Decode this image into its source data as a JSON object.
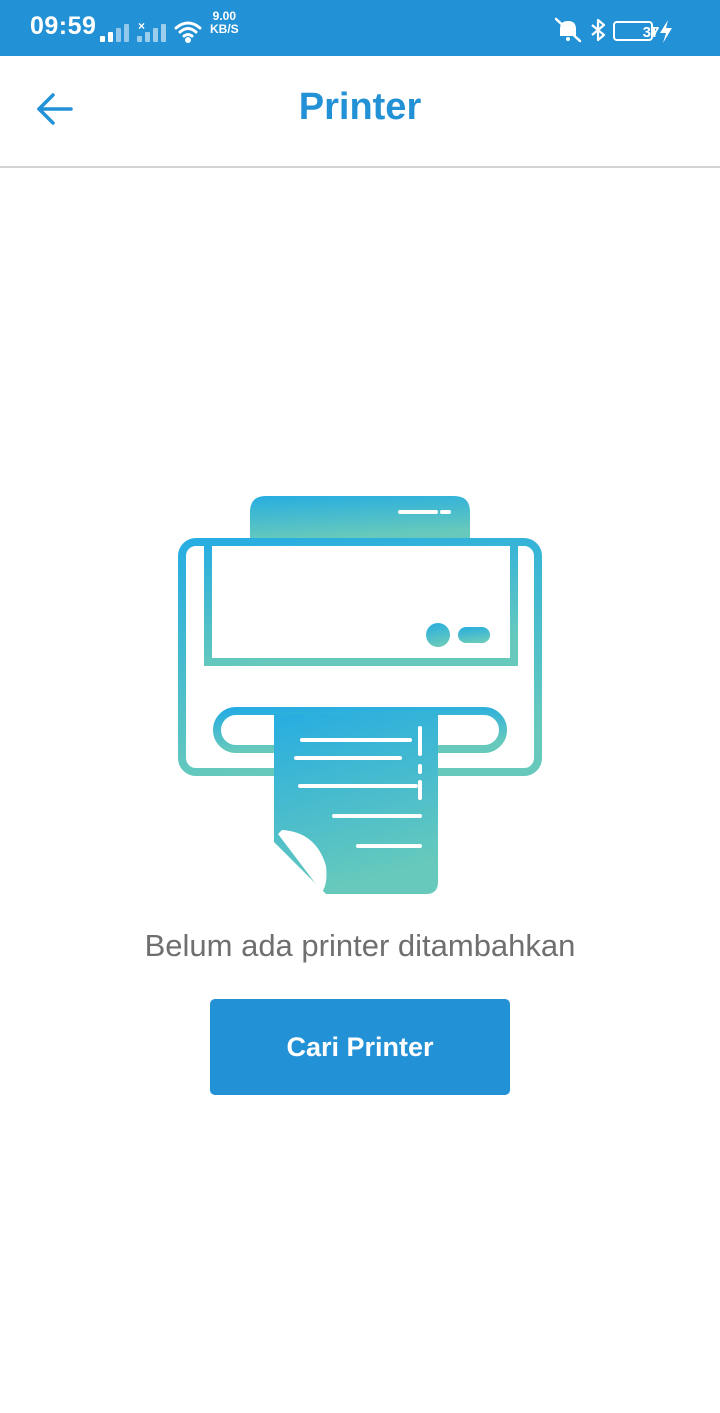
{
  "status_bar": {
    "time": "09:59",
    "net_speed_value": "9.00",
    "net_speed_unit": "KB/S",
    "battery_level": "37",
    "icons": [
      "signal-icon",
      "signal-no-service-icon",
      "wifi-icon",
      "mute-icon",
      "bluetooth-icon",
      "battery-icon",
      "charging-icon"
    ]
  },
  "app_bar": {
    "title": "Printer",
    "back_icon": "arrow-left-icon"
  },
  "empty_state": {
    "illustration": "printer-receipt-icon",
    "message": "Belum ada printer ditambahkan",
    "button_label": "Cari Printer"
  },
  "colors": {
    "primary": "#2391d6",
    "text_muted": "#6f6f6f",
    "gradient_top": "#29ade0",
    "gradient_bottom": "#66c8bd"
  }
}
